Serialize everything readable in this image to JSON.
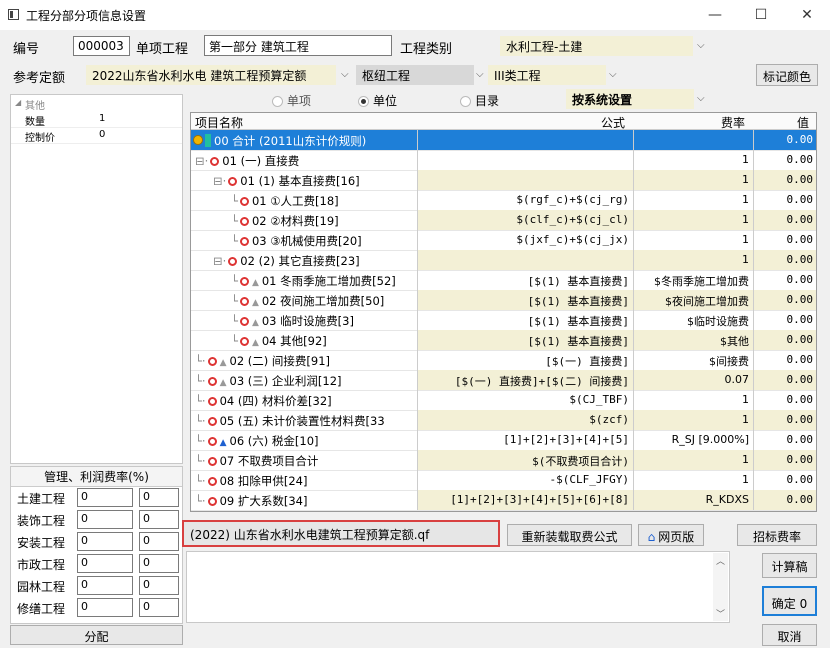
{
  "window": {
    "title": "工程分部分项信息设置",
    "minimize": "—",
    "maximize": "☐",
    "close": "✕"
  },
  "header": {
    "code_label": "编号",
    "code_value": "000003",
    "item_label": "单项工程",
    "item_value": "第一部分  建筑工程",
    "category_label": "工程类别",
    "category_value": "水利工程-土建",
    "quota_label": "参考定额",
    "quota_value": "2022山东省水利水电 建筑工程预算定额",
    "project_value": "枢纽工程",
    "class_value": "III类工程",
    "mark_color_label": "标记颜色"
  },
  "radios": {
    "single": "单项",
    "unit": "单位",
    "catalog": "目录",
    "setting": "按系统设置"
  },
  "props": {
    "group": "其他",
    "rows": [
      {
        "k": "数量",
        "v": "1"
      },
      {
        "k": "控制价",
        "v": "0"
      }
    ]
  },
  "fees": {
    "title": "管理、利润费率(%)",
    "rows": [
      {
        "name": "土建工程",
        "a": "0",
        "b": "0"
      },
      {
        "name": "装饰工程",
        "a": "0",
        "b": "0"
      },
      {
        "name": "安装工程",
        "a": "0",
        "b": "0"
      },
      {
        "name": "市政工程",
        "a": "0",
        "b": "0"
      },
      {
        "name": "园林工程",
        "a": "0",
        "b": "0"
      },
      {
        "name": "修缮工程",
        "a": "0",
        "b": "0"
      }
    ],
    "distribute": "分配"
  },
  "grid": {
    "headers": {
      "name": "项目名称",
      "formula": "公式",
      "rate": "费率",
      "value": "值"
    },
    "rows": [
      {
        "name": "00 合计 (2011山东计价规则)",
        "formula": "",
        "rate": "",
        "value": "0.00"
      },
      {
        "name": "01 (一) 直接费",
        "formula": "",
        "rate": "1",
        "value": "0.00"
      },
      {
        "name": "01 (1) 基本直接费[16]",
        "formula": "",
        "rate": "1",
        "value": "0.00"
      },
      {
        "name": "01 ①人工费[18]",
        "formula": "$(rgf_c)+$(cj_rg)",
        "rate": "1",
        "value": "0.00"
      },
      {
        "name": "02 ②材料费[19]",
        "formula": "$(clf_c)+$(cj_cl)",
        "rate": "1",
        "value": "0.00"
      },
      {
        "name": "03 ③机械使用费[20]",
        "formula": "$(jxf_c)+$(cj_jx)",
        "rate": "1",
        "value": "0.00"
      },
      {
        "name": "02 (2) 其它直接费[23]",
        "formula": "",
        "rate": "1",
        "value": "0.00"
      },
      {
        "name": "01 冬雨季施工增加费[52]",
        "formula": "[$(1) 基本直接费]",
        "rate": "$冬雨季施工增加费",
        "value": "0.00"
      },
      {
        "name": "02 夜间施工增加费[50]",
        "formula": "[$(1) 基本直接费]",
        "rate": "$夜间施工增加费",
        "value": "0.00"
      },
      {
        "name": "03 临时设施费[3]",
        "formula": "[$(1) 基本直接费]",
        "rate": "$临时设施费",
        "value": "0.00"
      },
      {
        "name": "04 其他[92]",
        "formula": "[$(1) 基本直接费]",
        "rate": "$其他",
        "value": "0.00"
      },
      {
        "name": "02 (二) 间接费[91]",
        "formula": "[$(一) 直接费]",
        "rate": "$间接费",
        "value": "0.00"
      },
      {
        "name": "03 (三) 企业利润[12]",
        "formula": "[$(一) 直接费]+[$(二) 间接费]",
        "rate": "0.07",
        "value": "0.00"
      },
      {
        "name": "04 (四) 材料价差[32]",
        "formula": "$(CJ_TBF)",
        "rate": "1",
        "value": "0.00"
      },
      {
        "name": "05 (五) 未计价装置性材料费[33",
        "formula": "$(zcf)",
        "rate": "1",
        "value": "0.00"
      },
      {
        "name": "06 (六) 税金[10]",
        "formula": "[1]+[2]+[3]+[4]+[5]",
        "rate": "R_SJ [9.000%]",
        "value": "0.00"
      },
      {
        "name": "07 不取费项目合计",
        "formula": "$(不取费项目合计)",
        "rate": "1",
        "value": "0.00"
      },
      {
        "name": "08 扣除甲供[24]",
        "formula": "-$(CLF_JFGY)",
        "rate": "1",
        "value": "0.00"
      },
      {
        "name": "09 扩大系数[34]",
        "formula": "[1]+[2]+[3]+[4]+[5]+[6]+[8]",
        "rate": "R_KDXS",
        "value": "0.00"
      }
    ]
  },
  "bottom": {
    "file_label": "(2022) 山东省水利水电建筑工程预算定额.qf",
    "reload": "重新装载取费公式",
    "web": "网页版",
    "bid_rate": "招标费率",
    "calc": "计算稿",
    "ok": "确定 0",
    "cancel": "取消"
  }
}
